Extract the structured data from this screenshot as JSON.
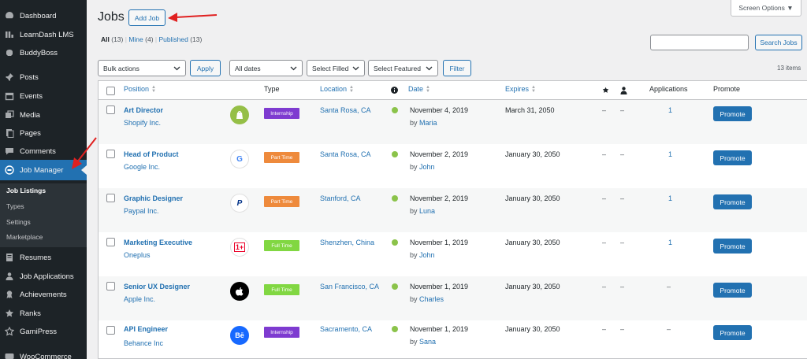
{
  "sidebar": {
    "items": [
      {
        "label": "Dashboard",
        "icon": "dashboard-icon"
      },
      {
        "label": "LearnDash LMS",
        "icon": "learndash-icon"
      },
      {
        "label": "BuddyBoss",
        "icon": "buddyboss-icon"
      },
      {
        "label": "Posts",
        "icon": "pin-icon"
      },
      {
        "label": "Events",
        "icon": "events-icon"
      },
      {
        "label": "Media",
        "icon": "media-icon"
      },
      {
        "label": "Pages",
        "icon": "pages-icon"
      },
      {
        "label": "Comments",
        "icon": "comment-icon"
      },
      {
        "label": "Job Manager",
        "icon": "job-manager-icon"
      },
      {
        "label": "Resumes",
        "icon": "resumes-icon"
      },
      {
        "label": "Job Applications",
        "icon": "applications-icon"
      },
      {
        "label": "Achievements",
        "icon": "achievements-icon"
      },
      {
        "label": "Ranks",
        "icon": "ranks-icon"
      },
      {
        "label": "GamiPress",
        "icon": "gamipress-icon"
      },
      {
        "label": "WooCommerce",
        "icon": "woocommerce-icon"
      }
    ],
    "submenu": [
      "Job Listings",
      "Types",
      "Settings",
      "Marketplace"
    ]
  },
  "header": {
    "title": "Jobs",
    "add_button": "Add Job",
    "screen_options": "Screen Options ▼"
  },
  "views": {
    "all": "All",
    "all_count": "(13)",
    "mine": "Mine",
    "mine_count": "(4)",
    "published": "Published",
    "published_count": "(13)"
  },
  "search": {
    "button": "Search Jobs",
    "value": ""
  },
  "filters": {
    "bulk_actions": "Bulk actions",
    "apply": "Apply",
    "dates": "All dates",
    "filled": "Select Filled",
    "featured": "Select Featured",
    "filter": "Filter",
    "count": "13 items"
  },
  "table": {
    "columns": {
      "position": "Position",
      "type": "Type",
      "location": "Location",
      "date": "Date",
      "expires": "Expires",
      "applications": "Applications",
      "promote": "Promote"
    },
    "rows": [
      {
        "title": "Art Director",
        "company": "Shopify Inc.",
        "logo": "shopify-logo",
        "type": "Internship",
        "type_color": "#7e3bd0",
        "location": "Santa Rosa, CA",
        "date": "November 4, 2019",
        "by": "by",
        "author": "Maria",
        "expires": "March 31, 2050",
        "featured": "–",
        "filled": "–",
        "applications": "1",
        "promote": "Promote"
      },
      {
        "title": "Head of Product",
        "company": "Google Inc.",
        "logo": "google-logo",
        "type": "Part Time",
        "type_color": "#ee8a3c",
        "location": "Santa Rosa, CA",
        "date": "November 2, 2019",
        "by": "by",
        "author": "John",
        "expires": "January 30, 2050",
        "featured": "–",
        "filled": "–",
        "applications": "1",
        "promote": "Promote"
      },
      {
        "title": "Graphic Designer",
        "company": "Paypal Inc.",
        "logo": "paypal-logo",
        "type": "Part Time",
        "type_color": "#ee8a3c",
        "location": "Stanford, CA",
        "date": "November 2, 2019",
        "by": "by",
        "author": "Luna",
        "expires": "January 30, 2050",
        "featured": "–",
        "filled": "–",
        "applications": "1",
        "promote": "Promote"
      },
      {
        "title": "Marketing Executive",
        "company": "Oneplus",
        "logo": "oneplus-logo",
        "type": "Full Time",
        "type_color": "#81d742",
        "location": "Shenzhen, China",
        "date": "November 1, 2019",
        "by": "by",
        "author": "John",
        "expires": "January 30, 2050",
        "featured": "–",
        "filled": "–",
        "applications": "1",
        "promote": "Promote"
      },
      {
        "title": "Senior UX Designer",
        "company": "Apple Inc.",
        "logo": "apple-logo",
        "type": "Full Time",
        "type_color": "#81d742",
        "location": "San Francisco, CA",
        "date": "November 1, 2019",
        "by": "by",
        "author": "Charles",
        "expires": "January 30, 2050",
        "featured": "–",
        "filled": "–",
        "applications": "–",
        "promote": "Promote"
      },
      {
        "title": "API Engineer",
        "company": "Behance Inc",
        "logo": "behance-logo",
        "type": "Internship",
        "type_color": "#7e3bd0",
        "location": "Sacramento, CA",
        "date": "November 1, 2019",
        "by": "by",
        "author": "Sana",
        "expires": "January 30, 2050",
        "featured": "–",
        "filled": "–",
        "applications": "–",
        "promote": "Promote"
      }
    ]
  },
  "logo_glyphs": {
    "google": "G",
    "paypal": "P",
    "oneplus": "1+",
    "behance": "Bē"
  },
  "colors": {
    "primary": "#2271b1",
    "sidebar": "#1d2327",
    "annotation_arrow": "#e02020"
  }
}
